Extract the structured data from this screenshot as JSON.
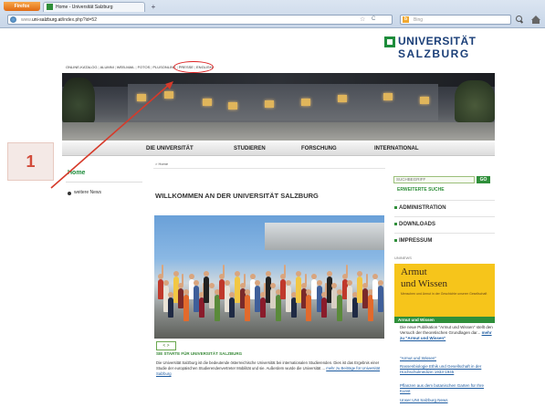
{
  "browser": {
    "firefox_label": "Firefox",
    "tab_title": "Home - Universität Salzburg",
    "new_tab": "+",
    "url_scheme": "www.",
    "url_host": "uni-salzburg.at",
    "url_path": "/index.php?id=52",
    "search_placeholder": "Bing",
    "bing_badge": "b",
    "star": "☆",
    "reload": "C"
  },
  "header": {
    "logo_line1": "UNIVERSITÄT",
    "logo_line2": "SALZBURG",
    "toplinks": [
      "ONLINE-KATALOG",
      "ALUMNI",
      "WEB-MAIL",
      "FOTOS",
      "PLUSONLINE",
      "PRESSE",
      "ENGLISH"
    ],
    "separator": "|"
  },
  "nav": {
    "items": [
      "DIE UNIVERSITÄT",
      "STUDIEREN",
      "FORSCHUNG",
      "INTERNATIONAL"
    ]
  },
  "sidebar": {
    "home": "Home",
    "news": "weitere News"
  },
  "main": {
    "breadcrumb": "> Home",
    "title": "WILLKOMMEN AN DER UNIVERSITÄT SALZBURG",
    "pager": "< >",
    "caption": "SIE STARTE FÜR UNIVERSITÄT SALZBURG",
    "body": "Die Universität Salzburg ist die bedeutende österreichische Universität bei internationalen Studierenden. Dies ist das Ergebnis einer Studie der europäischen Studierendenvertreter Mobilität und sie. Außerdem wurde die Universität ...",
    "more": "mehr zu Beiträge für Universität Salzburg"
  },
  "rightbar": {
    "search_placeholder": "SUCHBEGRIFF",
    "go": "GO",
    "advanced": "ERWEITERTE SUCHE",
    "nav": [
      "ADMINISTRATION",
      "DOWNLOADS",
      "IMPRESSUM"
    ],
    "uninews": "UNINEWS",
    "armut_line1": "Armut",
    "armut_line2": "und Wissen",
    "armut_sub": "Menschen und Armut in der Geschichte unserer Gesellschaft",
    "armut_band": "Armut und Wissen",
    "armut_text": "Die neue Publikation \"Armut und Wissen\" stellt den Versuch der theoretischen Grundlagen dar...",
    "armut_more": "mehr zu \"Armut und Wissen\"",
    "links": [
      "\"Armut und Wissen\"",
      "Rassenbiologie Ethik und Gesellschaft in der Hochschulmedizin 1933-1945",
      "Pflanzen aus dem botanischen Garten für Ihre Kunst",
      "Unser UNI Salzburg News"
    ]
  },
  "annotation": {
    "number": "1"
  },
  "colors": {
    "accent_green": "#2f8f3a",
    "logo_blue": "#1b3f78",
    "annotation_red": "#d22222"
  }
}
